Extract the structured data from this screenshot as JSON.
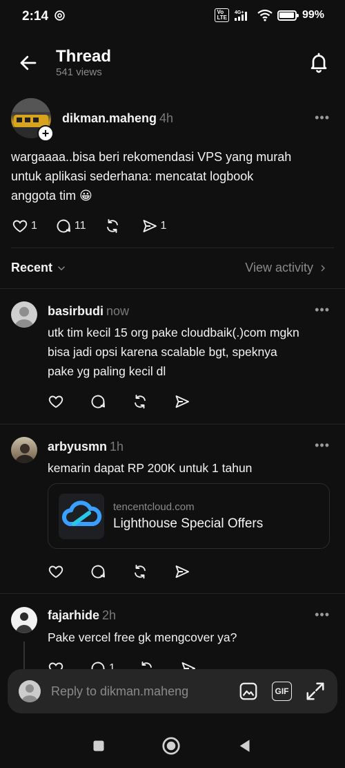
{
  "status_bar": {
    "time": "2:14",
    "network": "4G+",
    "volte": "Vo LTE",
    "battery": "99%",
    "battery_level": 0.99
  },
  "header": {
    "title": "Thread",
    "views": "541 views"
  },
  "post": {
    "username": "dikman.maheng",
    "time": "4h",
    "text_line1": "wargaaaa..bisa beri rekomendasi VPS yang murah",
    "text_line2": "untuk aplikasi sederhana: mencatat logbook",
    "text_line3": "anggota tim 😀",
    "likes": "1",
    "comments": "11",
    "shares": "1"
  },
  "sort": {
    "label": "Recent",
    "view_activity": "View activity"
  },
  "replies": [
    {
      "username": "basirbudi",
      "time": "now",
      "line1": "utk tim kecil 15 org pake cloudbaik(.)com mgkn",
      "line2": "bisa jadi opsi karena scalable bgt, speknya",
      "line3": "pake yg paling kecil dl"
    },
    {
      "username": "arbyusmn",
      "time": "1h",
      "line1": "kemarin dapat RP 200K untuk 1 tahun",
      "card": {
        "domain": "tencentcloud.com",
        "title": "Lighthouse Special Offers"
      }
    },
    {
      "username": "fajarhide",
      "time": "2h",
      "line1": "Pake vercel free gk mengcover ya?",
      "comments": "1"
    }
  ],
  "reply_bar": {
    "placeholder": "Reply to dikman.maheng"
  },
  "icons": {
    "back": "arrow-left-icon",
    "bell": "bell-icon",
    "like": "heart-icon",
    "comment": "comment-icon",
    "repost": "repost-icon",
    "share": "send-icon",
    "image": "image-icon",
    "gif": "gif-icon",
    "expand": "expand-icon"
  }
}
